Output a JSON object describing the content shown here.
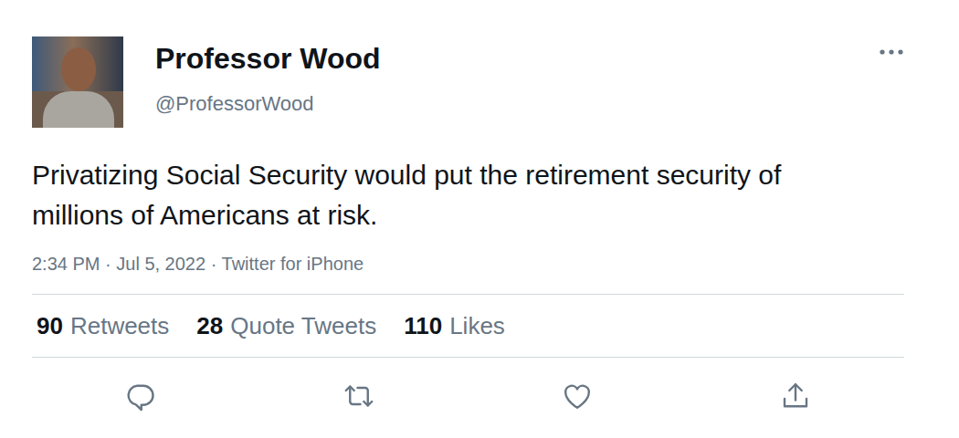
{
  "author": {
    "name": "Professor Wood",
    "handle": "@ProfessorWood"
  },
  "tweet": {
    "text": "Privatizing Social Security would put the retirement security of millions of Americans at risk.",
    "timestamp": "2:34 PM · Jul 5, 2022 · Twitter for iPhone"
  },
  "stats": [
    {
      "count": "90",
      "label": "Retweets"
    },
    {
      "count": "28",
      "label": "Quote Tweets"
    },
    {
      "count": "110",
      "label": "Likes"
    }
  ]
}
